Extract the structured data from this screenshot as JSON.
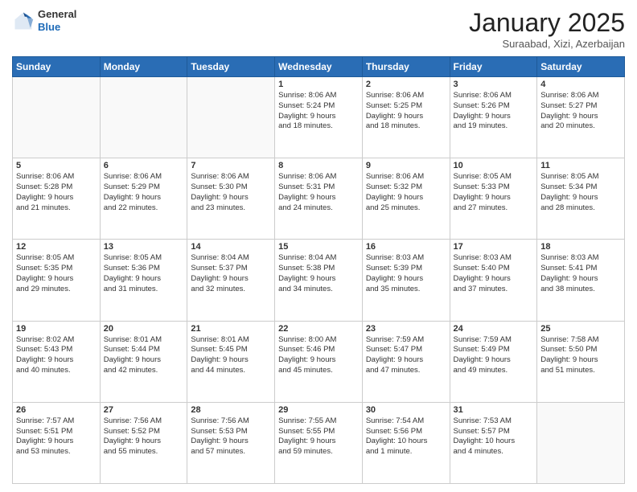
{
  "header": {
    "logo_line1": "General",
    "logo_line2": "Blue",
    "month": "January 2025",
    "location": "Suraabad, Xizi, Azerbaijan"
  },
  "weekdays": [
    "Sunday",
    "Monday",
    "Tuesday",
    "Wednesday",
    "Thursday",
    "Friday",
    "Saturday"
  ],
  "weeks": [
    [
      {
        "day": "",
        "info": ""
      },
      {
        "day": "",
        "info": ""
      },
      {
        "day": "",
        "info": ""
      },
      {
        "day": "1",
        "info": "Sunrise: 8:06 AM\nSunset: 5:24 PM\nDaylight: 9 hours\nand 18 minutes."
      },
      {
        "day": "2",
        "info": "Sunrise: 8:06 AM\nSunset: 5:25 PM\nDaylight: 9 hours\nand 18 minutes."
      },
      {
        "day": "3",
        "info": "Sunrise: 8:06 AM\nSunset: 5:26 PM\nDaylight: 9 hours\nand 19 minutes."
      },
      {
        "day": "4",
        "info": "Sunrise: 8:06 AM\nSunset: 5:27 PM\nDaylight: 9 hours\nand 20 minutes."
      }
    ],
    [
      {
        "day": "5",
        "info": "Sunrise: 8:06 AM\nSunset: 5:28 PM\nDaylight: 9 hours\nand 21 minutes."
      },
      {
        "day": "6",
        "info": "Sunrise: 8:06 AM\nSunset: 5:29 PM\nDaylight: 9 hours\nand 22 minutes."
      },
      {
        "day": "7",
        "info": "Sunrise: 8:06 AM\nSunset: 5:30 PM\nDaylight: 9 hours\nand 23 minutes."
      },
      {
        "day": "8",
        "info": "Sunrise: 8:06 AM\nSunset: 5:31 PM\nDaylight: 9 hours\nand 24 minutes."
      },
      {
        "day": "9",
        "info": "Sunrise: 8:06 AM\nSunset: 5:32 PM\nDaylight: 9 hours\nand 25 minutes."
      },
      {
        "day": "10",
        "info": "Sunrise: 8:05 AM\nSunset: 5:33 PM\nDaylight: 9 hours\nand 27 minutes."
      },
      {
        "day": "11",
        "info": "Sunrise: 8:05 AM\nSunset: 5:34 PM\nDaylight: 9 hours\nand 28 minutes."
      }
    ],
    [
      {
        "day": "12",
        "info": "Sunrise: 8:05 AM\nSunset: 5:35 PM\nDaylight: 9 hours\nand 29 minutes."
      },
      {
        "day": "13",
        "info": "Sunrise: 8:05 AM\nSunset: 5:36 PM\nDaylight: 9 hours\nand 31 minutes."
      },
      {
        "day": "14",
        "info": "Sunrise: 8:04 AM\nSunset: 5:37 PM\nDaylight: 9 hours\nand 32 minutes."
      },
      {
        "day": "15",
        "info": "Sunrise: 8:04 AM\nSunset: 5:38 PM\nDaylight: 9 hours\nand 34 minutes."
      },
      {
        "day": "16",
        "info": "Sunrise: 8:03 AM\nSunset: 5:39 PM\nDaylight: 9 hours\nand 35 minutes."
      },
      {
        "day": "17",
        "info": "Sunrise: 8:03 AM\nSunset: 5:40 PM\nDaylight: 9 hours\nand 37 minutes."
      },
      {
        "day": "18",
        "info": "Sunrise: 8:03 AM\nSunset: 5:41 PM\nDaylight: 9 hours\nand 38 minutes."
      }
    ],
    [
      {
        "day": "19",
        "info": "Sunrise: 8:02 AM\nSunset: 5:43 PM\nDaylight: 9 hours\nand 40 minutes."
      },
      {
        "day": "20",
        "info": "Sunrise: 8:01 AM\nSunset: 5:44 PM\nDaylight: 9 hours\nand 42 minutes."
      },
      {
        "day": "21",
        "info": "Sunrise: 8:01 AM\nSunset: 5:45 PM\nDaylight: 9 hours\nand 44 minutes."
      },
      {
        "day": "22",
        "info": "Sunrise: 8:00 AM\nSunset: 5:46 PM\nDaylight: 9 hours\nand 45 minutes."
      },
      {
        "day": "23",
        "info": "Sunrise: 7:59 AM\nSunset: 5:47 PM\nDaylight: 9 hours\nand 47 minutes."
      },
      {
        "day": "24",
        "info": "Sunrise: 7:59 AM\nSunset: 5:49 PM\nDaylight: 9 hours\nand 49 minutes."
      },
      {
        "day": "25",
        "info": "Sunrise: 7:58 AM\nSunset: 5:50 PM\nDaylight: 9 hours\nand 51 minutes."
      }
    ],
    [
      {
        "day": "26",
        "info": "Sunrise: 7:57 AM\nSunset: 5:51 PM\nDaylight: 9 hours\nand 53 minutes."
      },
      {
        "day": "27",
        "info": "Sunrise: 7:56 AM\nSunset: 5:52 PM\nDaylight: 9 hours\nand 55 minutes."
      },
      {
        "day": "28",
        "info": "Sunrise: 7:56 AM\nSunset: 5:53 PM\nDaylight: 9 hours\nand 57 minutes."
      },
      {
        "day": "29",
        "info": "Sunrise: 7:55 AM\nSunset: 5:55 PM\nDaylight: 9 hours\nand 59 minutes."
      },
      {
        "day": "30",
        "info": "Sunrise: 7:54 AM\nSunset: 5:56 PM\nDaylight: 10 hours\nand 1 minute."
      },
      {
        "day": "31",
        "info": "Sunrise: 7:53 AM\nSunset: 5:57 PM\nDaylight: 10 hours\nand 4 minutes."
      },
      {
        "day": "",
        "info": ""
      }
    ]
  ]
}
